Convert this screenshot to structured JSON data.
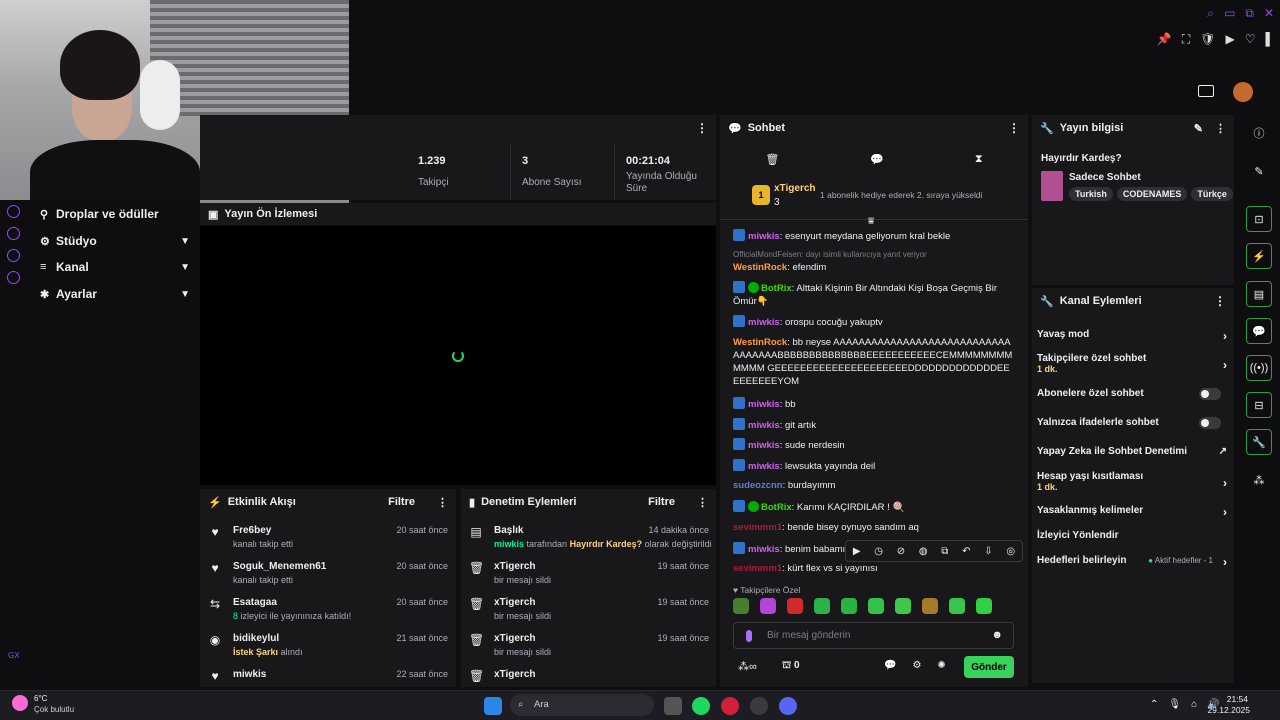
{
  "window": {
    "controls": [
      "⌕",
      "▭",
      "⧉",
      "✕"
    ],
    "toolbar": [
      "📌",
      "⛶",
      "🛡",
      "▶",
      "♡",
      "▌"
    ]
  },
  "nav": {
    "items": [
      {
        "label": "Droplar ve ödüller",
        "icon": "⚲"
      },
      {
        "label": "Stüdyo",
        "icon": "⚙"
      },
      {
        "label": "Kanal",
        "icon": "≡"
      },
      {
        "label": "Ayarlar",
        "icon": "✱"
      }
    ],
    "bottom": "GX"
  },
  "stats": [
    {
      "value": "1.239",
      "label": "Takipçi"
    },
    {
      "value": "3",
      "label": "Abone Sayısı"
    },
    {
      "value": "00:21:04",
      "label": "Yayında Olduğu Süre"
    }
  ],
  "preview": {
    "title": "Yayın Ön İzlemesi"
  },
  "activity": {
    "title": "Etkinlik Akışı",
    "filter": "Filtre",
    "items": [
      {
        "name": "Fre6bey",
        "sub": "kanalı takip etti",
        "time": "20 saat önce",
        "icon": "♥"
      },
      {
        "name": "Soguk_Menemen61",
        "sub": "kanalı takip etti",
        "time": "20 saat önce",
        "icon": "♥"
      },
      {
        "name": "Esatagaa",
        "sub_num": "8",
        "sub": "izleyici ile yayınınıza katıldı!",
        "time": "20 saat önce",
        "icon": "⇆"
      },
      {
        "name": "bidikeylul",
        "sub_hl": "İstek Şarkı",
        "sub": "alındı",
        "time": "21 saat önce",
        "icon": "◉"
      },
      {
        "name": "miwkis",
        "sub": "",
        "time": "22 saat önce",
        "icon": "♥"
      }
    ]
  },
  "mod": {
    "title": "Denetim Eylemleri",
    "filter": "Filtre",
    "items": [
      {
        "name": "Başlık",
        "time": "14 dakika önce",
        "sub_user": "miwkis",
        "sub_mid": "tarafından",
        "sub_hl": "Hayırdır Kardeş?",
        "sub": "olarak değiştirildi",
        "icon": "▤"
      },
      {
        "name": "xTigerch",
        "sub": "bir mesajı sildi",
        "time": "19 saat önce",
        "icon": "🗑"
      },
      {
        "name": "xTigerch",
        "sub": "bir mesajı sildi",
        "time": "19 saat önce",
        "icon": "🗑"
      },
      {
        "name": "xTigerch",
        "sub": "bir mesajı sildi",
        "time": "19 saat önce",
        "icon": "🗑"
      },
      {
        "name": "xTigerch",
        "sub": "",
        "time": "",
        "icon": "🗑"
      }
    ]
  },
  "chat": {
    "title": "Sohbet",
    "hype": {
      "user": "xTigerch",
      "count": "3",
      "text": "1 abonelik hediye ederek 2. sıraya yükseldi"
    },
    "messages": [
      {
        "user": "miwkis",
        "cls": "u-miwkis",
        "badge": true,
        "text": "esenyurt meydana geliyorum kral bekle"
      },
      {
        "reply": "OfficialMondFeisen: dayı isimli kullanıcıya yanıt veriyor",
        "user": "WestinRock",
        "cls": "u-westin",
        "text": "efendim"
      },
      {
        "user": "BotRix",
        "cls": "u-bot",
        "badge": true,
        "verified": true,
        "text": "Alttaki Kişinin Bir Altındaki Kişi Boşa Geçmiş Bir Ömür👇"
      },
      {
        "user": "miwkis",
        "cls": "u-miwkis",
        "badge": true,
        "text": "orospu cocuğu yakuptv"
      },
      {
        "user": "WestinRock",
        "cls": "u-westin",
        "text": "bb neyse AAAAAAAAAAAAAAAAAAAAAAAAAAAAAAAAAAABBBBBBBBBBBBBBEEEEEEEEEEECEMMMMMMMMMMMM GEEEEEEEEEEEEEEEEEEEEEDDDDDDDDDDDDDEEEEEEEEEYOM"
      },
      {
        "user": "miwkis",
        "cls": "u-miwkis",
        "badge": true,
        "text": "bb"
      },
      {
        "user": "miwkis",
        "cls": "u-miwkis",
        "badge": true,
        "text": "git artık"
      },
      {
        "user": "miwkis",
        "cls": "u-miwkis",
        "badge": true,
        "text": "sude nerdesin"
      },
      {
        "user": "miwkis",
        "cls": "u-miwkis",
        "badge": true,
        "text": "lewsukta yayında deil"
      },
      {
        "user": "sudeozcnn",
        "cls": "u-sudeo",
        "text": "burdayımm"
      },
      {
        "user": "BotRix",
        "cls": "u-bot",
        "badge": true,
        "verified": true,
        "text": "Karımı KAÇIRDILAR ! 🍭"
      },
      {
        "user": "sevimmm1",
        "cls": "u-sevim",
        "text": "bende bisey oynuyo sandım aq"
      },
      {
        "user": "miwkis",
        "cls": "u-miwkis",
        "badge": true,
        "text": "benim babamın"
      },
      {
        "user": "sevimmm1",
        "cls": "u-sevim",
        "text": "kürt flex vs si yayınısı"
      }
    ],
    "follower_only": "Takipçilere Özel",
    "placeholder": "Bir mesaj gönderin",
    "points": "0",
    "send": "Gönder"
  },
  "info": {
    "title": "Yayın bilgisi",
    "stream_title": "Hayırdır Kardeş?",
    "category": "Sadece Sohbet",
    "tags": [
      "Turkish",
      "CODENAMES",
      "Türkçe"
    ]
  },
  "channel": {
    "title": "Kanal Eylemleri",
    "items": [
      {
        "label": "Yavaş mod",
        "arrow": true
      },
      {
        "label": "Takipçilere özel sohbet",
        "sub": "1 dk.",
        "arrow": true
      },
      {
        "label": "Abonelere özel sohbet",
        "toggle": true
      },
      {
        "label": "Yalnızca ifadelerle sohbet",
        "toggle": true
      },
      {
        "label": "Yapay Zeka ile Sohbet Denetimi",
        "ext": true
      },
      {
        "label": "Hesap yaşı kısıtlaması",
        "sub": "1 dk.",
        "arrow": true
      },
      {
        "label": "Yasaklanmış kelimeler",
        "arrow": true
      },
      {
        "label": "İzleyici Yönlendir"
      },
      {
        "label": "Hedefleri belirleyin",
        "extra": "Aktif hedefler - 1",
        "arrow": true
      }
    ]
  },
  "taskbar": {
    "temp": "6°C",
    "weather": "Çok bulutlu",
    "search": "Ara",
    "time": "21:54",
    "date": "29.12.2025"
  }
}
